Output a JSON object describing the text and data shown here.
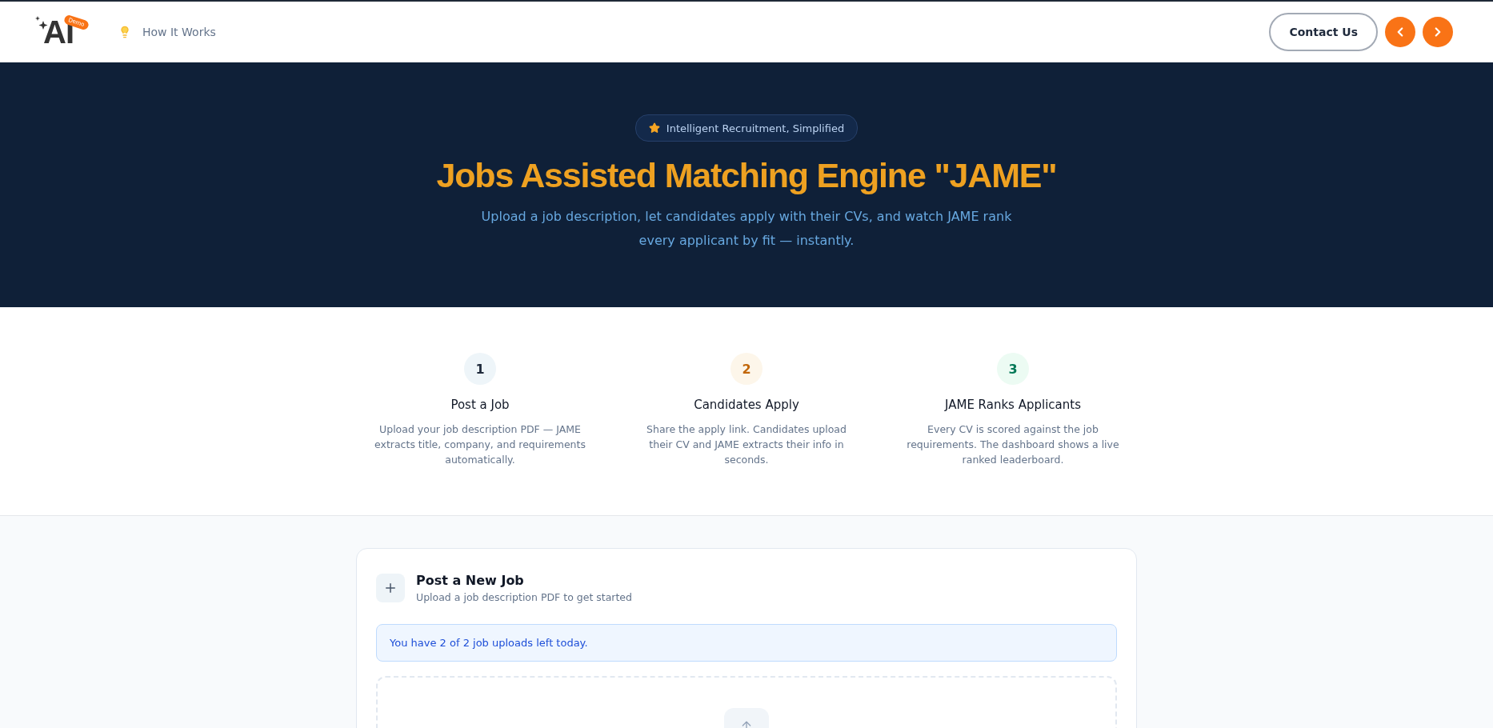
{
  "header": {
    "logo": {
      "text": "AI",
      "badge": "Demo"
    },
    "nav_link": "How It Works",
    "contact_button": "Contact Us"
  },
  "hero": {
    "badge": "Intelligent Recruitment, Simplified",
    "title": "Jobs Assisted Matching Engine \"JAME\"",
    "subtitle": "Upload a job description, let candidates apply with their CVs, and watch JAME rank every applicant by fit — instantly."
  },
  "steps": [
    {
      "number": "1",
      "title": "Post a Job",
      "description": "Upload your job description PDF — JAME extracts title, company, and requirements automatically.",
      "color": "#1e293b"
    },
    {
      "number": "2",
      "title": "Candidates Apply",
      "description": "Share the apply link. Candidates upload their CV and JAME extracts their info in seconds.",
      "color": "#c2670a"
    },
    {
      "number": "3",
      "title": "JAME Ranks Applicants",
      "description": "Every CV is scored against the job requirements. The dashboard shows a live ranked leaderboard.",
      "color": "#047857"
    }
  ],
  "post_job": {
    "title": "Post a New Job",
    "subtitle": "Upload a job description PDF to get started",
    "notice": "You have 2 of 2 job uploads left today."
  }
}
